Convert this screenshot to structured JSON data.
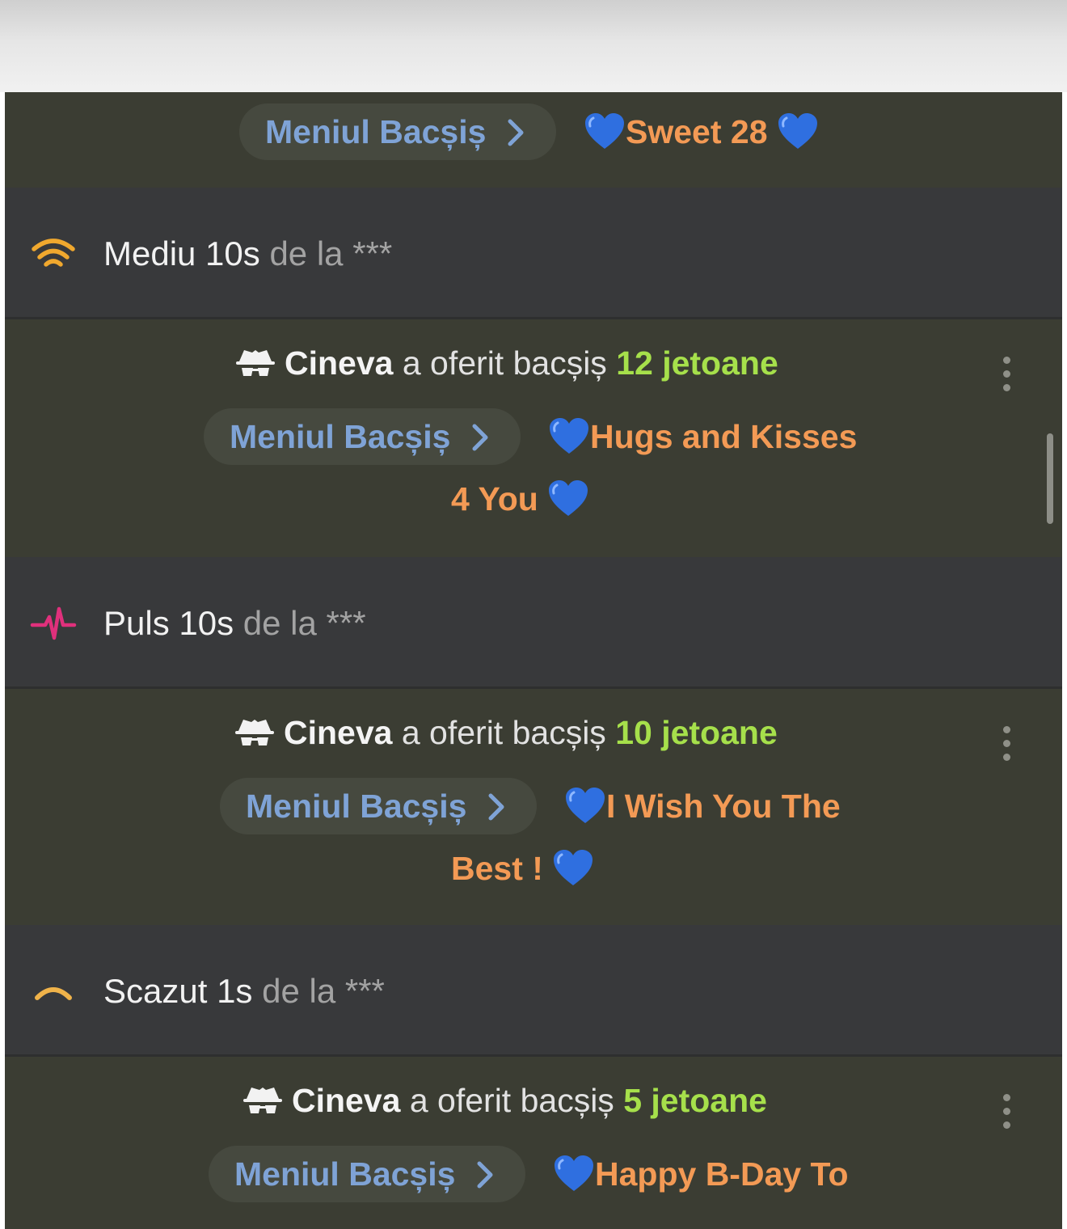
{
  "tip_menu_label": "Meniul Bacșiș",
  "messages": [
    {
      "text": "Sweet 28"
    },
    {
      "sender": "Cineva",
      "verb": "a oferit bacșiș",
      "amount": "12 jetoane",
      "text_line1": "Hugs and Kisses",
      "text_line2": "4 You"
    },
    {
      "sender": "Cineva",
      "verb": "a oferit bacșiș",
      "amount": "10 jetoane",
      "text_line1": "I Wish You The",
      "text_line2": "Best !"
    },
    {
      "sender": "Cineva",
      "verb": "a oferit bacșiș",
      "amount": "5 jetoane",
      "text_line1": "Happy B-Day To"
    }
  ],
  "vibrations": [
    {
      "level": "Mediu 10s",
      "from": "de la",
      "user": "***",
      "icon": "wifi-signal-icon",
      "color": "#f0a82e"
    },
    {
      "level": "Puls 10s",
      "from": "de la",
      "user": "***",
      "icon": "pulse-icon",
      "color": "#e0307c"
    },
    {
      "level": "Scazut 1s",
      "from": "de la",
      "user": "***",
      "icon": "low-signal-icon",
      "color": "#f0b34a"
    }
  ],
  "colors": {
    "tip_bg": "#3b3d33",
    "system_bg": "#38393b",
    "amount": "#a6e04b",
    "message": "#f39a55",
    "menu_link": "#7fa3d6",
    "heart": "#2f6fe0"
  }
}
